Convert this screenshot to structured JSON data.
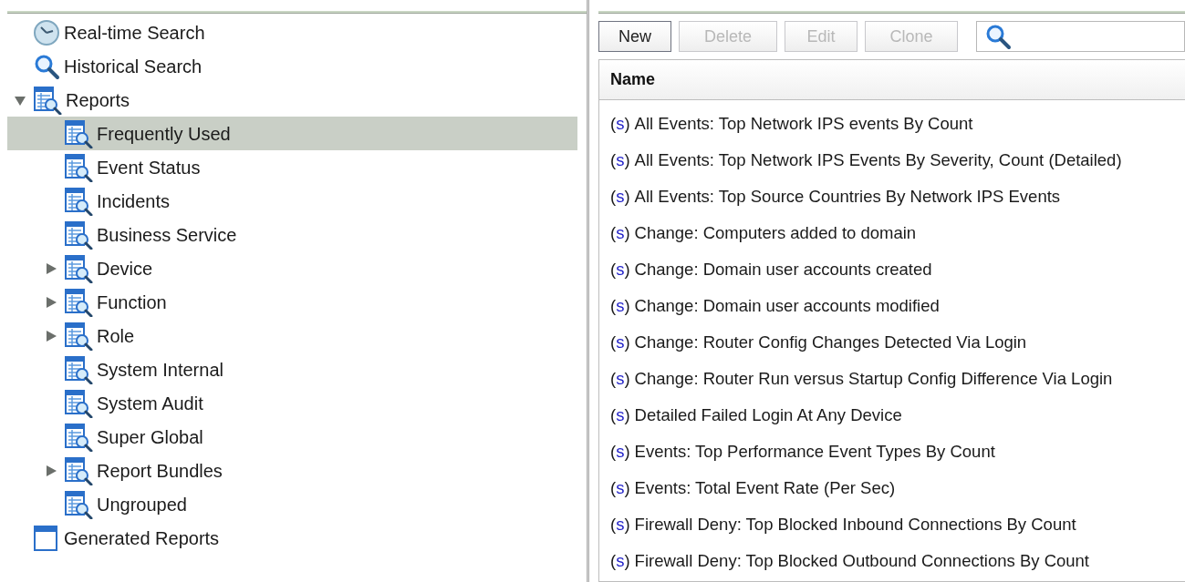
{
  "tree": [
    {
      "label": "Real-time Search",
      "kind": "clock",
      "selected": false
    },
    {
      "label": "Historical Search",
      "kind": "search",
      "selected": false
    },
    {
      "label": "Reports",
      "kind": "report",
      "selected": false,
      "expanded": true,
      "children": [
        {
          "label": "Frequently Used",
          "kind": "report",
          "selected": true
        },
        {
          "label": "Event Status",
          "kind": "report",
          "selected": false
        },
        {
          "label": "Incidents",
          "kind": "report",
          "selected": false
        },
        {
          "label": "Business Service",
          "kind": "report",
          "selected": false
        },
        {
          "label": "Device",
          "kind": "report",
          "selected": false,
          "expanded": false
        },
        {
          "label": "Function",
          "kind": "report",
          "selected": false,
          "expanded": false
        },
        {
          "label": "Role",
          "kind": "report",
          "selected": false,
          "expanded": false
        },
        {
          "label": "System Internal",
          "kind": "report",
          "selected": false
        },
        {
          "label": "System Audit",
          "kind": "report",
          "selected": false
        },
        {
          "label": "Super Global",
          "kind": "report",
          "selected": false
        },
        {
          "label": "Report Bundles",
          "kind": "report",
          "selected": false,
          "expanded": false
        },
        {
          "label": "Ungrouped",
          "kind": "report",
          "selected": false
        }
      ]
    },
    {
      "label": "Generated Reports",
      "kind": "list",
      "selected": false
    }
  ],
  "toolbar": [
    {
      "label": "New",
      "disabled": false
    },
    {
      "label": "Delete",
      "disabled": true
    },
    {
      "label": "Edit",
      "disabled": true
    },
    {
      "label": "Clone",
      "disabled": true
    }
  ],
  "table": {
    "columns": [
      "Name"
    ],
    "rows": [
      {
        "tag": "(s)",
        "name": "All Events: Top Network IPS events By Count"
      },
      {
        "tag": "(s)",
        "name": "All Events: Top Network IPS Events By Severity, Count (Detailed)"
      },
      {
        "tag": "(s)",
        "name": "All Events: Top Source Countries By Network IPS Events"
      },
      {
        "tag": "(s)",
        "name": "Change: Computers added to domain"
      },
      {
        "tag": "(s)",
        "name": "Change: Domain user accounts created"
      },
      {
        "tag": "(s)",
        "name": "Change: Domain user accounts modified"
      },
      {
        "tag": "(s)",
        "name": "Change: Router Config Changes Detected Via Login"
      },
      {
        "tag": "(s)",
        "name": "Change: Router Run versus Startup Config Difference Via Login"
      },
      {
        "tag": "(s)",
        "name": "Detailed Failed Login At Any Device"
      },
      {
        "tag": "(s)",
        "name": "Events: Top Performance Event Types By Count"
      },
      {
        "tag": "(s)",
        "name": "Events: Total Event Rate (Per Sec)"
      },
      {
        "tag": "(s)",
        "name": "Firewall Deny: Top Blocked Inbound Connections By Count"
      },
      {
        "tag": "(s)",
        "name": "Firewall Deny: Top Blocked Outbound Connections By Count"
      }
    ]
  }
}
